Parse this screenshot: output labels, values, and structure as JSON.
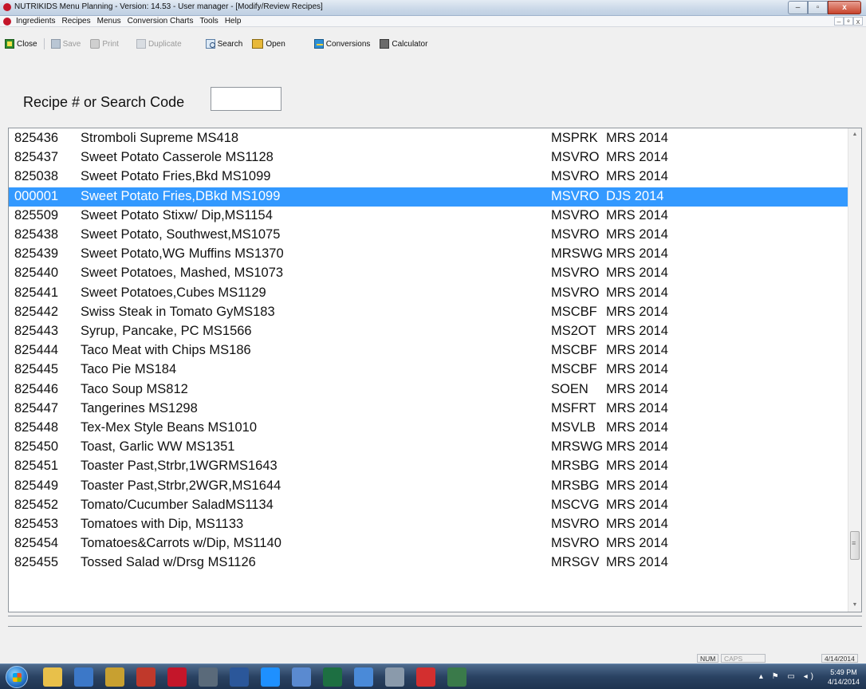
{
  "window": {
    "title": "NUTRIKIDS Menu Planning - Version: 14.53 - User manager - [Modify/Review Recipes]",
    "buttons": {
      "minimize": "–",
      "maximize": "▫",
      "close": "x"
    }
  },
  "menubar": {
    "items": [
      "Ingredients",
      "Recipes",
      "Menus",
      "Conversion Charts",
      "Tools",
      "Help"
    ],
    "mdi": {
      "minimize": "–",
      "restore": "ᵉ",
      "close": "x"
    }
  },
  "toolbar": {
    "close": "Close",
    "save": "Save",
    "print": "Print",
    "duplicate": "Duplicate",
    "search": "Search",
    "open": "Open",
    "conversions": "Conversions",
    "calculator": "Calculator"
  },
  "search": {
    "label": "Recipe # or Search Code",
    "value": ""
  },
  "recipes": [
    {
      "code": "825436",
      "name": "Stromboli Supreme MS418",
      "category": "MSPRK",
      "source": "MRS 2014"
    },
    {
      "code": "825437",
      "name": "Sweet Potato Casserole MS1128",
      "category": "MSVRO",
      "source": "MRS 2014"
    },
    {
      "code": "825038",
      "name": "Sweet Potato Fries,Bkd MS1099",
      "category": "MSVRO",
      "source": "MRS 2014"
    },
    {
      "code": "000001",
      "name": "Sweet Potato Fries,DBkd MS1099",
      "category": "MSVRO",
      "source": "DJS 2014",
      "selected": true
    },
    {
      "code": "825509",
      "name": "Sweet Potato Stixw/ Dip,MS1154",
      "category": "MSVRO",
      "source": "MRS 2014"
    },
    {
      "code": "825438",
      "name": "Sweet Potato, Southwest,MS1075",
      "category": "MSVRO",
      "source": "MRS 2014"
    },
    {
      "code": "825439",
      "name": "Sweet Potato,WG Muffins MS1370",
      "category": "MRSWG",
      "source": "MRS 2014"
    },
    {
      "code": "825440",
      "name": "Sweet Potatoes, Mashed, MS1073",
      "category": "MSVRO",
      "source": "MRS 2014"
    },
    {
      "code": "825441",
      "name": "Sweet Potatoes,Cubes MS1129",
      "category": "MSVRO",
      "source": "MRS 2014"
    },
    {
      "code": "825442",
      "name": "Swiss Steak in Tomato GyMS183",
      "category": "MSCBF",
      "source": "MRS 2014"
    },
    {
      "code": "825443",
      "name": "Syrup, Pancake, PC MS1566",
      "category": "MS2OT",
      "source": "MRS 2014"
    },
    {
      "code": "825444",
      "name": "Taco Meat with Chips MS186",
      "category": "MSCBF",
      "source": "MRS 2014"
    },
    {
      "code": "825445",
      "name": "Taco Pie MS184",
      "category": "MSCBF",
      "source": "MRS 2014"
    },
    {
      "code": "825446",
      "name": "Taco Soup MS812",
      "category": "SOEN",
      "source": "MRS 2014"
    },
    {
      "code": "825447",
      "name": "Tangerines MS1298",
      "category": "MSFRT",
      "source": "MRS 2014"
    },
    {
      "code": "825448",
      "name": "Tex-Mex Style Beans MS1010",
      "category": "MSVLB",
      "source": "MRS 2014"
    },
    {
      "code": "825450",
      "name": "Toast, Garlic WW MS1351",
      "category": "MRSWG",
      "source": "MRS 2014"
    },
    {
      "code": "825451",
      "name": "Toaster Past,Strbr,1WGRMS1643",
      "category": "MRSBG",
      "source": "MRS 2014"
    },
    {
      "code": "825449",
      "name": "Toaster Past,Strbr,2WGR,MS1644",
      "category": "MRSBG",
      "source": "MRS 2014"
    },
    {
      "code": "825452",
      "name": "Tomato/Cucumber SaladMS1134",
      "category": "MSCVG",
      "source": "MRS 2014"
    },
    {
      "code": "825453",
      "name": "Tomatoes with Dip, MS1133",
      "category": "MSVRO",
      "source": "MRS 2014"
    },
    {
      "code": "825454",
      "name": "Tomatoes&Carrots w/Dip, MS1140",
      "category": "MSVRO",
      "source": "MRS 2014"
    },
    {
      "code": "825455",
      "name": "Tossed Salad w/Drsg MS1126",
      "category": "MRSGV",
      "source": "MRS 2014"
    }
  ],
  "statusbar": {
    "num": "NUM",
    "caps": "CAPS",
    "date": "4/14/2014"
  },
  "taskbar": {
    "apps": [
      "explorer-icon",
      "media-player-icon",
      "tool-icon",
      "publisher-icon",
      "nutrikids-icon",
      "app-icon",
      "word-icon",
      "internet-explorer-icon",
      "calculator-icon",
      "excel-icon",
      "network-icon",
      "settings-icon",
      "acrobat-icon",
      "system-monitor-icon"
    ],
    "time": "5:49 PM",
    "date": "4/14/2014"
  },
  "colors": {
    "selection": "#3399ff",
    "taskbar": "#2a4262"
  }
}
